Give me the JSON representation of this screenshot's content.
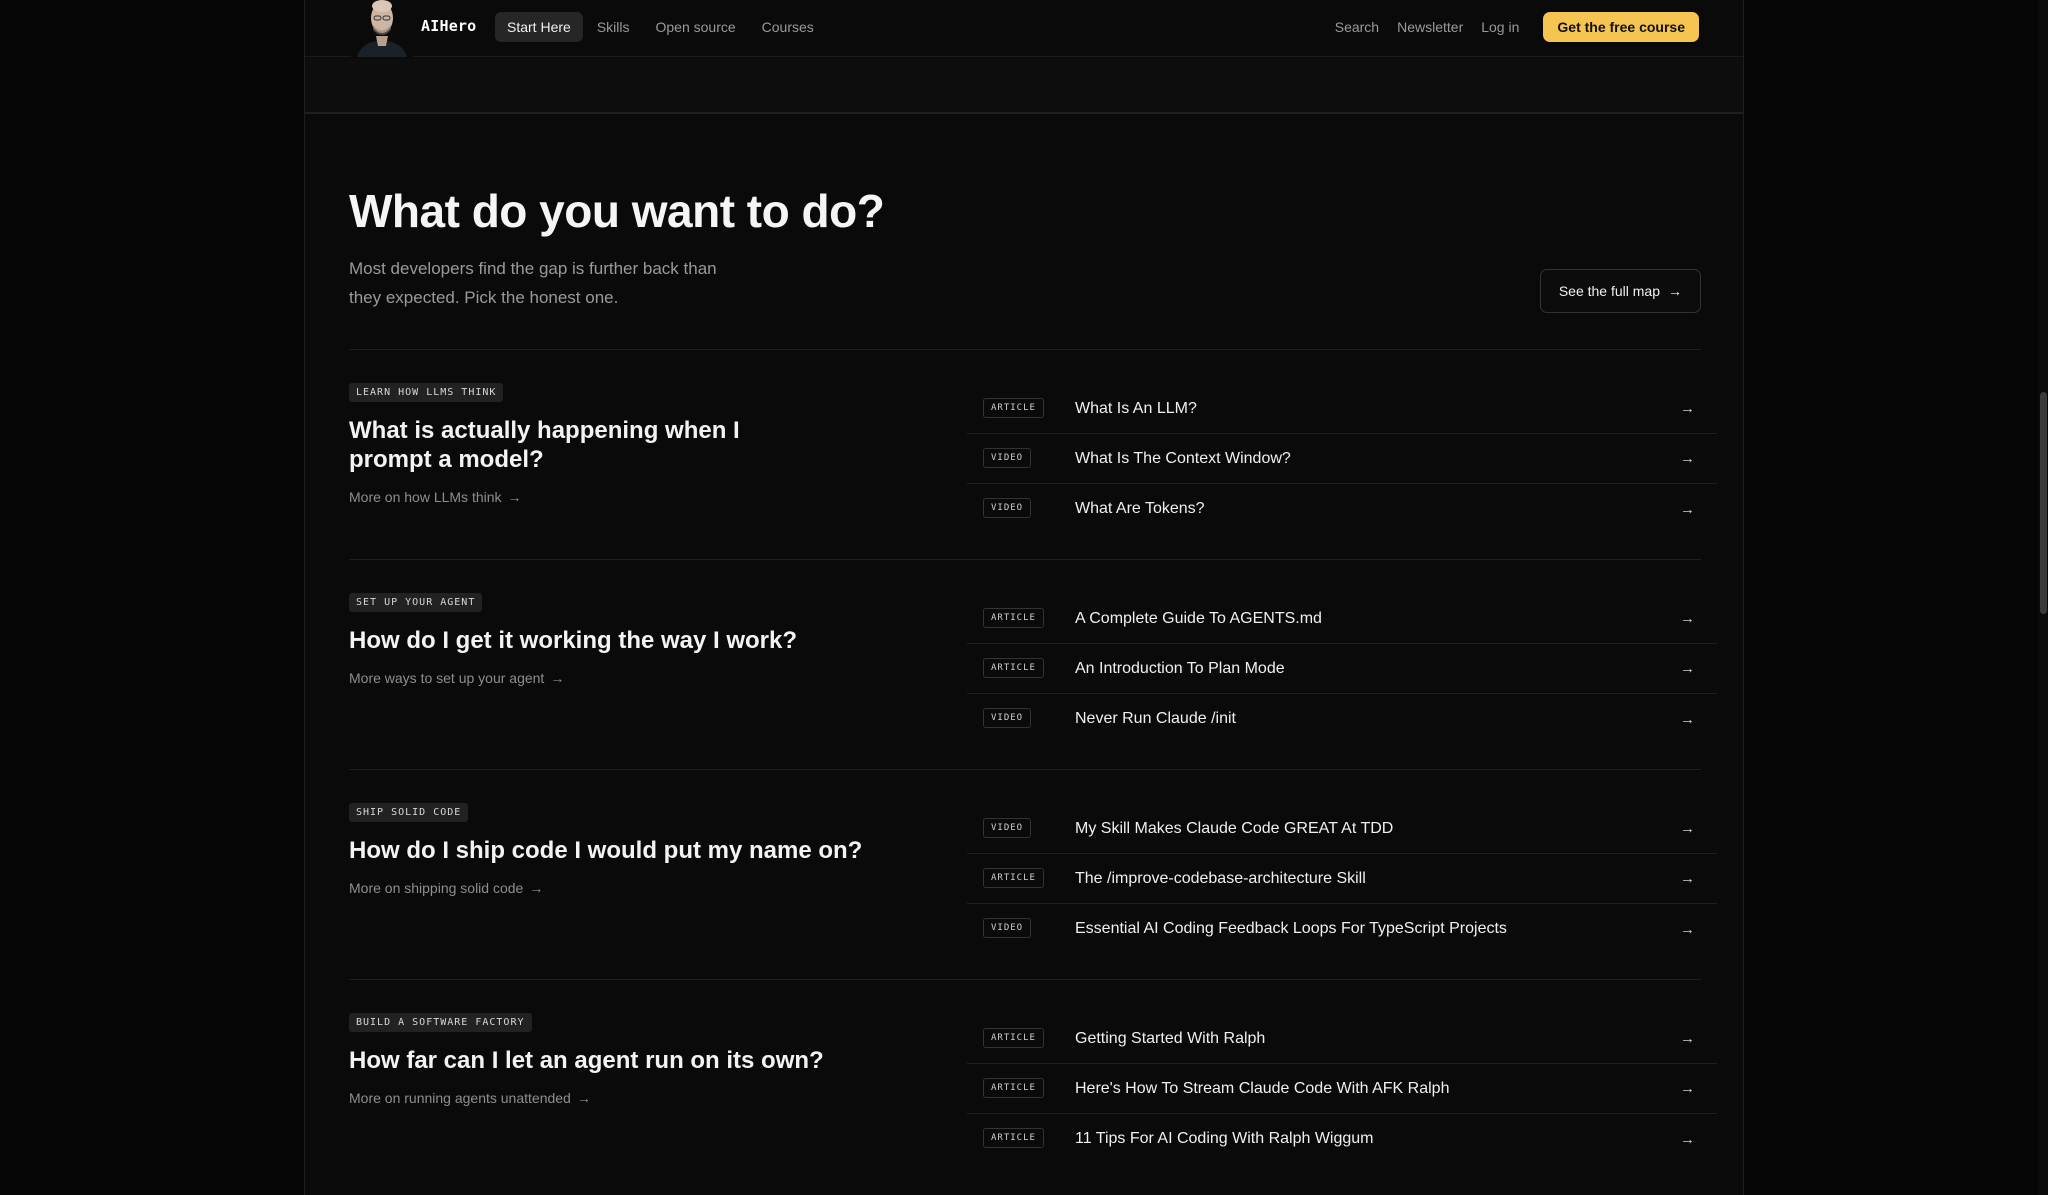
{
  "header": {
    "brand": "AIHero",
    "nav": [
      {
        "label": "Start Here",
        "active": true
      },
      {
        "label": "Skills",
        "active": false
      },
      {
        "label": "Open source",
        "active": false
      },
      {
        "label": "Courses",
        "active": false
      }
    ],
    "search": "Search",
    "newsletter": "Newsletter",
    "login": "Log in",
    "cta": "Get the free course",
    "cta_color": "#f5c451"
  },
  "main": {
    "title": "What do you want to do?",
    "subtitle": "Most developers find the gap is further back than they expected. Pick the honest one.",
    "full_map": "See the full map",
    "arrow_icon": "→",
    "sections": [
      {
        "tag": "LEARN HOW LLMS THINK",
        "question": "What is actually happening when I prompt a model?",
        "more": "More on how LLMs think",
        "resources": [
          {
            "type": "ARTICLE",
            "title": "What Is An LLM?"
          },
          {
            "type": "VIDEO",
            "title": "What Is The Context Window?"
          },
          {
            "type": "VIDEO",
            "title": "What Are Tokens?"
          }
        ]
      },
      {
        "tag": "SET UP YOUR AGENT",
        "question": "How do I get it working the way I work?",
        "more": "More ways to set up your agent",
        "resources": [
          {
            "type": "ARTICLE",
            "title": "A Complete Guide To AGENTS.md"
          },
          {
            "type": "ARTICLE",
            "title": "An Introduction To Plan Mode"
          },
          {
            "type": "VIDEO",
            "title": "Never Run Claude /init"
          }
        ]
      },
      {
        "tag": "SHIP SOLID CODE",
        "question": "How do I ship code I would put my name on?",
        "more": "More on shipping solid code",
        "resources": [
          {
            "type": "VIDEO",
            "title": "My Skill Makes Claude Code GREAT At TDD"
          },
          {
            "type": "ARTICLE",
            "title": "The /improve-codebase-architecture Skill"
          },
          {
            "type": "VIDEO",
            "title": "Essential AI Coding Feedback Loops For TypeScript Projects"
          }
        ]
      },
      {
        "tag": "BUILD A SOFTWARE FACTORY",
        "question": "How far can I let an agent run on its own?",
        "more": "More on running agents unattended",
        "resources": [
          {
            "type": "ARTICLE",
            "title": "Getting Started With Ralph"
          },
          {
            "type": "ARTICLE",
            "title": "Here's How To Stream Claude Code With AFK Ralph"
          },
          {
            "type": "ARTICLE",
            "title": "11 Tips For AI Coding With Ralph Wiggum"
          }
        ]
      }
    ]
  }
}
